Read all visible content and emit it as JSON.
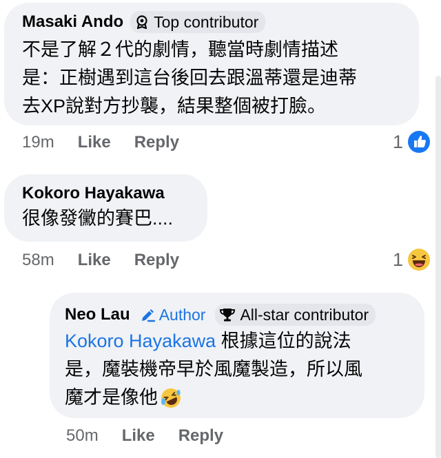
{
  "comments": [
    {
      "author": "Masaki Ando",
      "badge": "Top contributor",
      "badge_icon": "top-contributor-icon",
      "text_lines": [
        "不是了解２代的劇情，聽當時劇情描述",
        "是：正樹遇到這台後回去跟溫蒂還是迪蒂",
        "去XP說對方抄襲，結果整個被打臉。"
      ],
      "time": "19m",
      "like_label": "Like",
      "reply_label": "Reply",
      "reaction_count": "1",
      "reaction_icon": "like-icon"
    },
    {
      "author": "Kokoro Hayakawa",
      "text_lines": [
        "很像發黴的賽巴...."
      ],
      "time": "58m",
      "like_label": "Like",
      "reply_label": "Reply",
      "reaction_count": "1",
      "reaction_icon": "laughing-emoji-icon"
    }
  ],
  "reply": {
    "author": "Neo Lau",
    "author_tag": "Author",
    "author_tag_icon": "pencil-icon",
    "badge": "All-star contributor",
    "badge_icon": "trophy-icon",
    "mention": "Kokoro Hayakawa",
    "text_line1_rest": " 根據這位的說法",
    "text_line2": "是，魔裝機帝早於風魔製造，所以風",
    "text_line3": "魔才是像他",
    "emoji_icon": "rofl-emoji-icon",
    "time": "50m",
    "like_label": "Like",
    "reply_label": "Reply"
  },
  "colors": {
    "bubble": "#f0f2f5",
    "badge_bg": "#e4e6eb",
    "link_blue": "#1b74e4",
    "meta_gray": "#65676b"
  }
}
